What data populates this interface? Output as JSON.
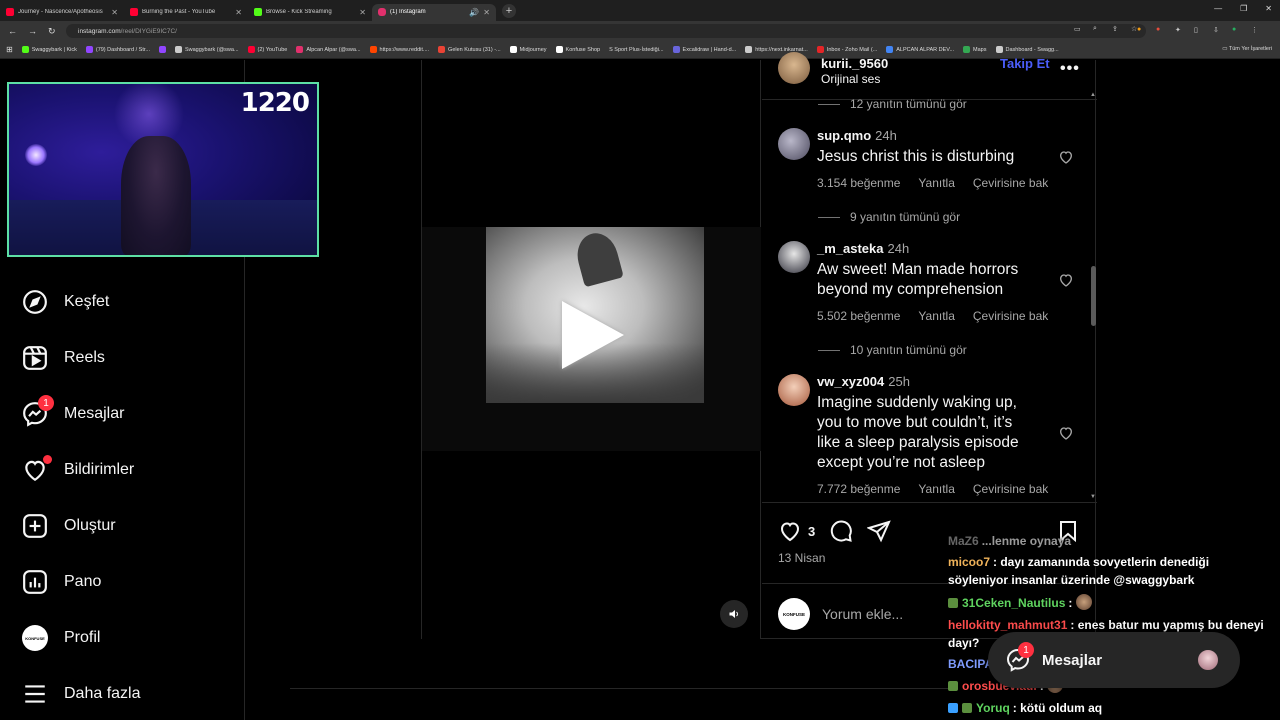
{
  "browser": {
    "tabs": [
      {
        "label": "Journey - Nascence/Apotheosis",
        "color": "#ff0033",
        "active": false
      },
      {
        "label": "Burning the Past - YouTube",
        "color": "#ff0033",
        "active": false
      },
      {
        "label": "Browse - Kick Streaming",
        "color": "#53fc18",
        "active": false
      },
      {
        "label": "(1) Instagram",
        "color": "#e1306c",
        "active": true
      }
    ],
    "url_host": "instagram.com",
    "url_path": "/reel/DIYGiE9IC7C/",
    "bookmarks": [
      {
        "label": "Swaggybark | Kick",
        "color": "#53fc18"
      },
      {
        "label": "(79) Dashboard / Str...",
        "color": "#9146ff"
      },
      {
        "label": "",
        "color": "#9146ff"
      },
      {
        "label": "Swaggybark (@swa...",
        "color": "#cccccc"
      },
      {
        "label": "(2) YouTube",
        "color": "#ff0033"
      },
      {
        "label": "Alpcan Alpar (@swa...",
        "color": "#e1306c"
      },
      {
        "label": "https://www.reddit....",
        "color": "#ff4500"
      },
      {
        "label": "Gelen Kutusu (31) -...",
        "color": "#ea4335"
      },
      {
        "label": "Midjourney",
        "color": "#ffffff"
      },
      {
        "label": "Konfuse Shop",
        "color": "#ffffff"
      },
      {
        "label": "S Sport Plus-İstediği...",
        "color": "#1e1e1e"
      },
      {
        "label": "Excalidraw | Hand-d...",
        "color": "#6965db"
      },
      {
        "label": "https://next.inkarnat...",
        "color": "#cccccc"
      },
      {
        "label": "Inbox - Zoho Mail (...",
        "color": "#e42527"
      },
      {
        "label": "ALPCAN ALPAR DEV...",
        "color": "#4285f4"
      },
      {
        "label": "Maps",
        "color": "#34a853"
      },
      {
        "label": "Dashboard - Swagg...",
        "color": "#cccccc"
      }
    ],
    "all_bookmarks": "Tüm Yer İşaretleri"
  },
  "webcam": {
    "counter": "1220",
    "border_color": "#5de0a5"
  },
  "sidebar": {
    "items": [
      {
        "label": "Keşfet",
        "icon": "compass-icon"
      },
      {
        "label": "Reels",
        "icon": "reels-icon"
      },
      {
        "label": "Mesajlar",
        "icon": "messenger-icon",
        "badge": "1"
      },
      {
        "label": "Bildirimler",
        "icon": "heart-icon"
      },
      {
        "label": "Oluştur",
        "icon": "plus-square-icon"
      },
      {
        "label": "Pano",
        "icon": "dashboard-icon"
      },
      {
        "label": "Profil",
        "icon": "profile-avatar"
      },
      {
        "label": "Daha fazla",
        "icon": "menu-icon"
      }
    ],
    "profile_avatar_text": "KONFUSE"
  },
  "post": {
    "username": "kurii._9560",
    "audio": "Orijinal ses",
    "follow": "Takip Et",
    "more": "•••",
    "replies_top": "12 yanıtın tümünü gör",
    "comments": [
      {
        "user": "sup.qmo",
        "time": "24h",
        "text": "Jesus christ this is disturbing",
        "likes": "3.154 beğenme",
        "reply": "Yanıtla",
        "translate": "Çevirisine bak",
        "replies": "9 yanıtın tümünü gör"
      },
      {
        "user": "_m_asteka",
        "time": "24h",
        "text": "Aw sweet! Man made horrors beyond my comprehension",
        "likes": "5.502 beğenme",
        "reply": "Yanıtla",
        "translate": "Çevirisine bak",
        "replies": "10 yanıtın tümünü gör"
      },
      {
        "user": "vw_xyz004",
        "time": "25h",
        "text": "Imagine suddenly waking up, you to move but couldn’t, it’s like a sleep paralysis episode except you’re not asleep",
        "likes": "7.772 beğenme",
        "reply": "Yanıtla",
        "translate": "Çevirisine bak"
      }
    ],
    "like_count": "3",
    "date": "13 Nisan",
    "comment_placeholder": "Yorum ekle...",
    "comment_avatar_text": "KONFUSE"
  },
  "chat": [
    {
      "user": "MaZ6",
      "user_color": "#aaaaaa",
      "text": "...lenme oynaya",
      "gem": false
    },
    {
      "user": "micoo7",
      "user_color": "#f0b35a",
      "text": ": dayı zamanında sovyetlerin denediği söyleniyor insanlar üzerinde @swaggybark",
      "gem": false
    },
    {
      "user": "31Ceken_Nautilus",
      "user_color": "#5fd35f",
      "text": ":",
      "gem": true
    },
    {
      "user": "hellokitty_mahmut31",
      "user_color": "#ff4d4d",
      "text": ": enes batur mu yapmış bu deneyi dayı?",
      "gem": false
    },
    {
      "user": "BACIPAKEYLEYENO",
      "user_color": "#7f9cff",
      "text": "",
      "gem": false
    },
    {
      "user": "orosbueviadi",
      "user_color": "#ff4d4d",
      "text": ":",
      "gem": true
    },
    {
      "user": "Yoruq",
      "user_color": "#5fd35f",
      "text": ": kötü oldum aq",
      "gem": true
    }
  ],
  "messages_pill": {
    "label": "Mesajlar",
    "badge": "1"
  }
}
